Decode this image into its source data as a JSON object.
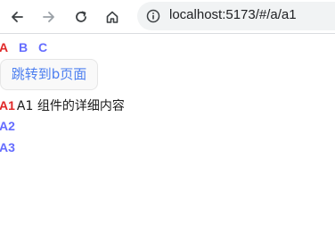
{
  "browser": {
    "url": "localhost:5173/#/a/a1",
    "icons": {
      "back": "arrow-left-icon",
      "forward": "arrow-right-icon",
      "reload": "reload-icon",
      "home": "home-icon",
      "site_info": "info-icon"
    }
  },
  "nav": {
    "links": [
      {
        "label": "A",
        "active": true
      },
      {
        "label": "B",
        "active": false
      },
      {
        "label": "C",
        "active": false
      }
    ]
  },
  "jump_button": {
    "label": "跳转到b页面"
  },
  "sub_routes": [
    {
      "label": "A1",
      "active": true,
      "detail": "A1 组件的详细内容"
    },
    {
      "label": "A2",
      "active": false
    },
    {
      "label": "A3",
      "active": false
    }
  ],
  "colors": {
    "active_link": "#e02828",
    "link": "#646cff",
    "button_text": "#4d7ff0"
  }
}
